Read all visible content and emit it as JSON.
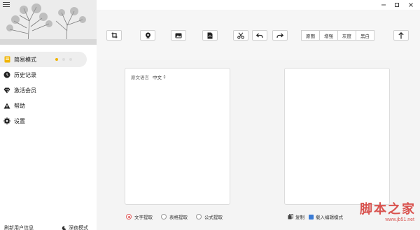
{
  "sidebar": {
    "items": [
      {
        "label": "简易模式",
        "icon": "notebook-icon"
      },
      {
        "label": "历史记录",
        "icon": "clock-icon"
      },
      {
        "label": "激活会员",
        "icon": "diamond-icon"
      },
      {
        "label": "帮助",
        "icon": "warning-triangle-icon"
      },
      {
        "label": "设置",
        "icon": "gear-icon"
      }
    ],
    "footer_left": "刷新用户信息",
    "footer_right": "深夜模式"
  },
  "toolbar": {
    "tools": [
      "crop-icon",
      "webcam-icon",
      "image-icon",
      "pdf-icon",
      "cut-icon",
      "undo-icon",
      "redo-icon"
    ],
    "filters": [
      "原图",
      "增强",
      "灰度",
      "黑白"
    ],
    "upload_icon": "upload-arrow-icon"
  },
  "source": {
    "lang_label": "原文语言",
    "lang_value": "中文"
  },
  "extract_modes": [
    {
      "label": "文字提取",
      "checked": true
    },
    {
      "label": "表格提取",
      "checked": false
    },
    {
      "label": "公式提取",
      "checked": false
    }
  ],
  "actions": {
    "copy": "复制",
    "import": "载入编辑模式"
  },
  "watermark": {
    "main": "脚本之家",
    "sub": "www.jb51.net"
  },
  "colors": {
    "accent": "#f0b400",
    "radio_checked": "#e06060",
    "watermark": "#d9534f"
  }
}
